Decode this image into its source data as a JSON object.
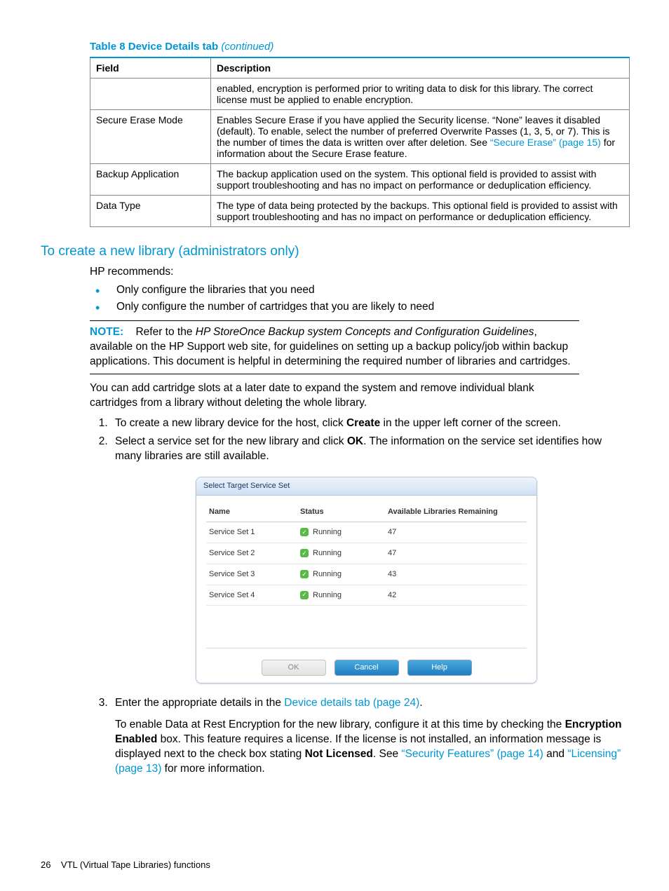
{
  "table": {
    "title": "Table 8 Device Details tab",
    "continued": "(continued)",
    "headers": {
      "field": "Field",
      "description": "Description"
    },
    "rows": [
      {
        "field": "",
        "desc": "enabled, encryption is performed prior to writing data to disk for this library. The correct license must be applied to enable encryption."
      },
      {
        "field": "Secure Erase Mode",
        "desc_pre": "Enables Secure Erase if you have applied the Security license. “None” leaves it disabled (default). To enable, select the number of preferred Overwrite Passes (1, 3, 5, or 7). This is the number of times the data is written over after deletion. See ",
        "link": "“Secure Erase” (page 15)",
        "desc_post": " for information about the Secure Erase feature."
      },
      {
        "field": "Backup Application",
        "desc": "The backup application used on the system. This optional field is provided to assist with support troubleshooting and has no impact on performance or deduplication efficiency."
      },
      {
        "field": "Data Type",
        "desc": "The type of data being protected by the backups. This optional field is provided to assist with support troubleshooting and has no impact on performance or deduplication efficiency."
      }
    ]
  },
  "section_heading": "To create a new library (administrators only)",
  "recommends_intro": "HP recommends:",
  "recommends": [
    "Only configure the libraries that you need",
    "Only configure the number of cartridges that you are likely to need"
  ],
  "note": {
    "label": "NOTE:",
    "pre": "Refer to the ",
    "italic": "HP StoreOnce Backup system Concepts and Configuration Guidelines",
    "post": ", available on the HP Support web site, for guidelines on setting up a backup policy/job within backup applications. This document is helpful in determining the required number of libraries and cartridges."
  },
  "para_addcart": "You can add cartridge slots at a later date to expand the system and remove individual blank cartridges from a library without deleting the whole library.",
  "steps": {
    "s1_pre": "To create a new library device for the host, click ",
    "s1_bold": "Create",
    "s1_post": " in the upper left corner of the screen.",
    "s2_pre": "Select a service set for the new library and click ",
    "s2_bold": "OK",
    "s2_post": ". The information on the service set identifies how many libraries are still available.",
    "s3_pre": "Enter the appropriate details in the ",
    "s3_link": "Device details tab (page 24)",
    "s3_post": ".",
    "s3b_pre": "To enable Data at Rest Encryption for the new library, configure it at this time by checking the ",
    "s3b_bold1": "Encryption Enabled",
    "s3b_mid1": " box. This feature requires a license. If the license is not installed, an information message is displayed next to the check box stating ",
    "s3b_bold2": "Not Licensed",
    "s3b_mid2": ". See ",
    "s3b_link1": "“Security Features” (page 14)",
    "s3b_mid3": " and ",
    "s3b_link2": "“Licensing” (page 13)",
    "s3b_end": " for more information."
  },
  "dialog": {
    "title": "Select Target Service Set",
    "headers": {
      "name": "Name",
      "status": "Status",
      "avail": "Available Libraries Remaining"
    },
    "rows": [
      {
        "name": "Service Set 1",
        "status": "Running",
        "avail": "47"
      },
      {
        "name": "Service Set 2",
        "status": "Running",
        "avail": "47"
      },
      {
        "name": "Service Set 3",
        "status": "Running",
        "avail": "43"
      },
      {
        "name": "Service Set 4",
        "status": "Running",
        "avail": "42"
      }
    ],
    "buttons": {
      "ok": "OK",
      "cancel": "Cancel",
      "help": "Help"
    }
  },
  "footer": {
    "page": "26",
    "title": "VTL (Virtual Tape Libraries) functions"
  }
}
